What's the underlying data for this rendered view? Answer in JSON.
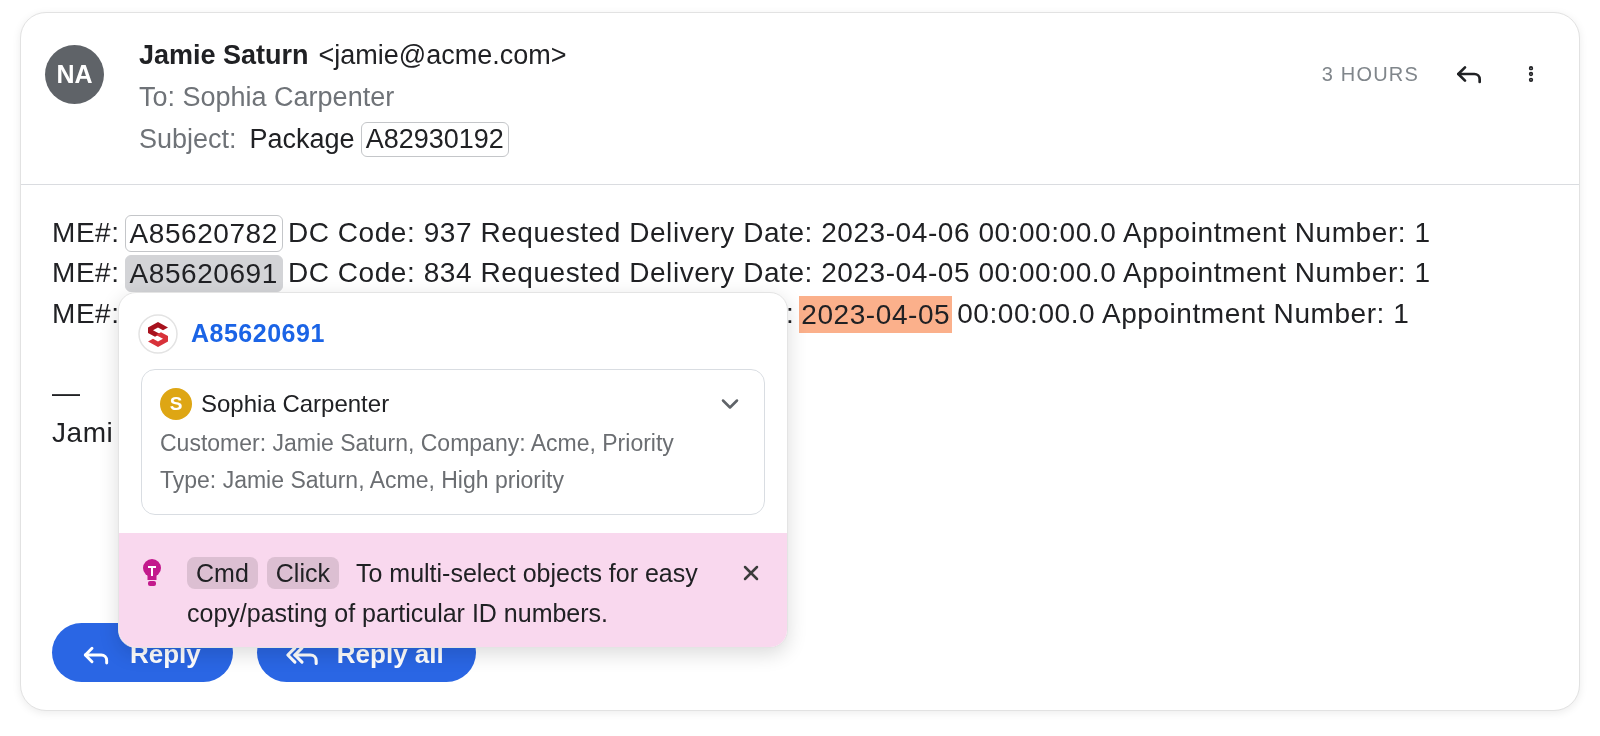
{
  "email": {
    "sender": {
      "initials": "NA",
      "name": "Jamie Saturn",
      "address": "<jamie@acme.com>"
    },
    "recipient": "To: Sophia Carpenter",
    "subject": {
      "label": "Subject:",
      "text": "Package",
      "id": {
        "text": "A82930192",
        "selected": false
      }
    },
    "time": "3 HOURS",
    "body": {
      "lines": [
        {
          "segments": [
            {
              "kind": "text",
              "text": "ME#:"
            },
            {
              "kind": "id",
              "text": "A85620782",
              "selected": false
            },
            {
              "kind": "text",
              "text": "DC Code: 937 Requested Delivery Date: 2023-04-06 00:00:00.0 Appointment Number: 1"
            }
          ]
        },
        {
          "segments": [
            {
              "kind": "text",
              "text": "ME#:"
            },
            {
              "kind": "id",
              "text": "A85620691",
              "selected": true
            },
            {
              "kind": "text",
              "text": "DC Code: 834 Requested Delivery Date: 2023-04-05 00:00:00.0 Appointment Number: 1"
            }
          ]
        },
        {
          "segments": [
            {
              "kind": "text",
              "text": "ME#:"
            }
          ],
          "right_of_popup": [
            {
              "kind": "text",
              "text": ":"
            },
            {
              "kind": "highlight",
              "text": "2023-04-05"
            },
            {
              "kind": "text",
              "text": "00:00:00.0 Appointment Number: 1"
            }
          ]
        }
      ],
      "signature": [
        "—",
        "Jami"
      ]
    },
    "buttons": [
      {
        "kind": "reply",
        "label": "Reply"
      },
      {
        "kind": "reply_all",
        "label": "Reply all"
      }
    ]
  },
  "popup": {
    "id": "A85620691",
    "contact": {
      "initial": "S",
      "name": "Sophia Carpenter",
      "details": [
        "Customer: Jamie Saturn, Company: Acme, Priority",
        "Type: Jamie Saturn, Acme, High priority"
      ]
    },
    "tip": {
      "keys": [
        "Cmd",
        "Click"
      ],
      "text": "To multi-select objects for easy copy/pasting of particular ID numbers."
    }
  }
}
